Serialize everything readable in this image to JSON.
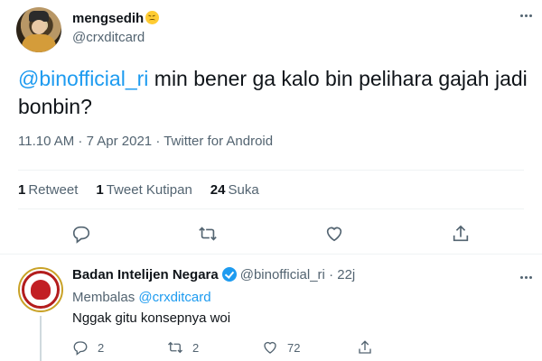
{
  "tweet": {
    "display_name": "mengsedih",
    "emoji_icon": "weary-face-emoji",
    "handle": "@crxditcard",
    "mention": "@binofficial_ri",
    "body": " min bener ga kalo bin pelihara gajah jadi bonbin?",
    "meta": "11.10 AM · 7 Apr 2021 · Twitter for Android",
    "stats": {
      "retweets_count": "1",
      "retweets_label": "Retweet",
      "quotes_count": "1",
      "quotes_label": "Tweet Kutipan",
      "likes_count": "24",
      "likes_label": "Suka"
    }
  },
  "reply": {
    "display_name": "Badan Intelijen Negara",
    "handle": "@binofficial_ri",
    "separator": "·",
    "time": "22j",
    "replying_prefix": "Membalas ",
    "replying_to": "@crxditcard",
    "body": "Nggak gitu konsepnya woi",
    "reply_count": "2",
    "retweet_count": "2",
    "like_count": "72"
  },
  "colors": {
    "accent": "#1d9bf0",
    "secondary_text": "#536471",
    "primary_text": "#0f1419"
  }
}
